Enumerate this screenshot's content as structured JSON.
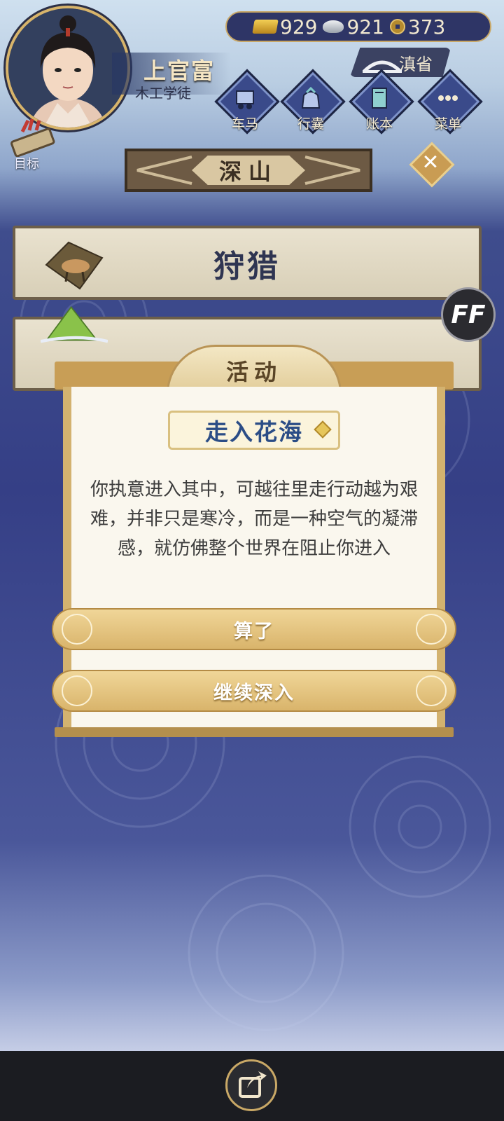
{
  "player": {
    "name": "上官富",
    "title": "木工学徒"
  },
  "currency": {
    "gold": "929",
    "silver": "921",
    "copper": "373"
  },
  "location": "滇省",
  "menu": [
    {
      "label": "车马",
      "icon": "carriage-icon"
    },
    {
      "label": "行囊",
      "icon": "bag-icon"
    },
    {
      "label": "账本",
      "icon": "ledger-icon"
    },
    {
      "label": "菜单",
      "icon": "more-icon"
    }
  ],
  "goal_label": "目标",
  "area_title": "深山",
  "activities": [
    "狩猎"
  ],
  "ff_label": "FF",
  "dialog": {
    "tab_title": "活动",
    "event_title": "走入花海",
    "description": "你执意进入其中，可越往里走行动越为艰难，并非只是寒冷，而是一种空气的凝滞感，就仿佛整个世界在阻止你进入",
    "cancel_label": "算了",
    "continue_label": "继续深入"
  }
}
